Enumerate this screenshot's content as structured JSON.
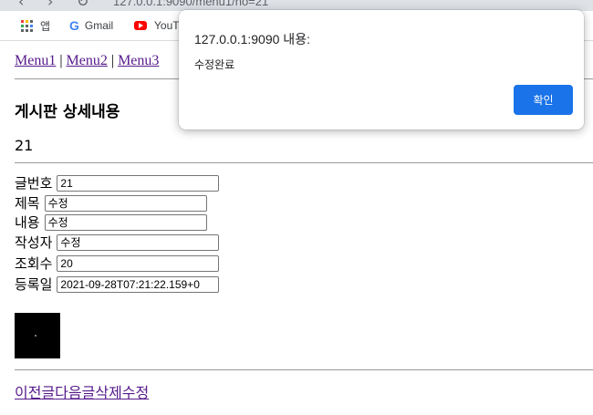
{
  "browser": {
    "url_partial": "127.0.0.1:9090/menu1/no=21",
    "bookmarks": [
      {
        "label": "앱",
        "icon": "apps-grid-icon"
      },
      {
        "label": "Gmail",
        "icon": "google-icon"
      },
      {
        "label": "YouT",
        "icon": "youtube-icon"
      }
    ]
  },
  "menu": {
    "items": [
      "Menu1",
      "Menu2",
      "Menu3"
    ],
    "separator": "|"
  },
  "page": {
    "title": "게시판 상세내용",
    "post_number": "21"
  },
  "form": {
    "fields": [
      {
        "label": "글번호",
        "value": "21"
      },
      {
        "label": "제목",
        "value": "수정"
      },
      {
        "label": "내용",
        "value": "수정"
      },
      {
        "label": "작성자",
        "value": "수정"
      },
      {
        "label": "조회수",
        "value": "20"
      },
      {
        "label": "등록일",
        "value": "2021-09-28T07:21:22.159+0"
      }
    ]
  },
  "actions": {
    "prev": "이전글",
    "next": "다음글",
    "delete": "삭제",
    "edit": "수정"
  },
  "dialog": {
    "origin": "127.0.0.1:9090 내용:",
    "message": "수정완료",
    "ok_label": "확인",
    "ok_color": "#1a73e8"
  }
}
